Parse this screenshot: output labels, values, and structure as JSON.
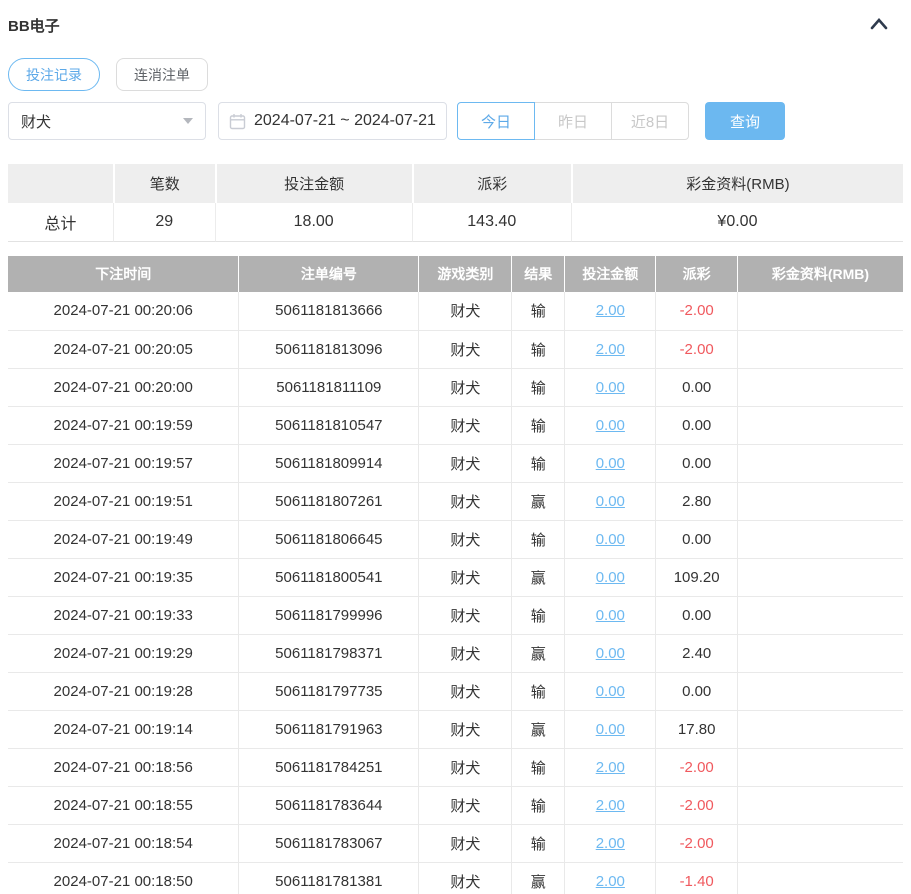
{
  "panel": {
    "title": "BB电子"
  },
  "tabs": [
    {
      "label": "投注记录",
      "active": true
    },
    {
      "label": "连消注单",
      "active": false
    }
  ],
  "filters": {
    "game_select": {
      "value": "财犬"
    },
    "date_range": {
      "value": "2024-07-21 ~ 2024-07-21"
    },
    "quick_buttons": [
      {
        "label": "今日",
        "active": true
      },
      {
        "label": "昨日",
        "active": false
      },
      {
        "label": "近8日",
        "active": false
      }
    ],
    "search_label": "查询"
  },
  "summary": {
    "headers": [
      "",
      "笔数",
      "投注金额",
      "派彩",
      "彩金资料(RMB)"
    ],
    "row": {
      "label": "总计",
      "count": "29",
      "bet_amount": "18.00",
      "payout": "143.40",
      "bonus": "¥0.00"
    }
  },
  "records": {
    "headers": [
      "下注时间",
      "注单编号",
      "游戏类别",
      "结果",
      "投注金额",
      "派彩",
      "彩金资料(RMB)"
    ],
    "rows": [
      {
        "time": "2024-07-21 00:20:06",
        "order_id": "5061181813666",
        "game": "财犬",
        "result": "输",
        "bet": "2.00",
        "payout": "-2.00",
        "bonus": ""
      },
      {
        "time": "2024-07-21 00:20:05",
        "order_id": "5061181813096",
        "game": "财犬",
        "result": "输",
        "bet": "2.00",
        "payout": "-2.00",
        "bonus": ""
      },
      {
        "time": "2024-07-21 00:20:00",
        "order_id": "5061181811109",
        "game": "财犬",
        "result": "输",
        "bet": "0.00",
        "payout": "0.00",
        "bonus": ""
      },
      {
        "time": "2024-07-21 00:19:59",
        "order_id": "5061181810547",
        "game": "财犬",
        "result": "输",
        "bet": "0.00",
        "payout": "0.00",
        "bonus": ""
      },
      {
        "time": "2024-07-21 00:19:57",
        "order_id": "5061181809914",
        "game": "财犬",
        "result": "输",
        "bet": "0.00",
        "payout": "0.00",
        "bonus": ""
      },
      {
        "time": "2024-07-21 00:19:51",
        "order_id": "5061181807261",
        "game": "财犬",
        "result": "赢",
        "bet": "0.00",
        "payout": "2.80",
        "bonus": ""
      },
      {
        "time": "2024-07-21 00:19:49",
        "order_id": "5061181806645",
        "game": "财犬",
        "result": "输",
        "bet": "0.00",
        "payout": "0.00",
        "bonus": ""
      },
      {
        "time": "2024-07-21 00:19:35",
        "order_id": "5061181800541",
        "game": "财犬",
        "result": "赢",
        "bet": "0.00",
        "payout": "109.20",
        "bonus": ""
      },
      {
        "time": "2024-07-21 00:19:33",
        "order_id": "5061181799996",
        "game": "财犬",
        "result": "输",
        "bet": "0.00",
        "payout": "0.00",
        "bonus": ""
      },
      {
        "time": "2024-07-21 00:19:29",
        "order_id": "5061181798371",
        "game": "财犬",
        "result": "赢",
        "bet": "0.00",
        "payout": "2.40",
        "bonus": ""
      },
      {
        "time": "2024-07-21 00:19:28",
        "order_id": "5061181797735",
        "game": "财犬",
        "result": "输",
        "bet": "0.00",
        "payout": "0.00",
        "bonus": ""
      },
      {
        "time": "2024-07-21 00:19:14",
        "order_id": "5061181791963",
        "game": "财犬",
        "result": "赢",
        "bet": "0.00",
        "payout": "17.80",
        "bonus": ""
      },
      {
        "time": "2024-07-21 00:18:56",
        "order_id": "5061181784251",
        "game": "财犬",
        "result": "输",
        "bet": "2.00",
        "payout": "-2.00",
        "bonus": ""
      },
      {
        "time": "2024-07-21 00:18:55",
        "order_id": "5061181783644",
        "game": "财犬",
        "result": "输",
        "bet": "2.00",
        "payout": "-2.00",
        "bonus": ""
      },
      {
        "time": "2024-07-21 00:18:54",
        "order_id": "5061181783067",
        "game": "财犬",
        "result": "输",
        "bet": "2.00",
        "payout": "-2.00",
        "bonus": ""
      },
      {
        "time": "2024-07-21 00:18:50",
        "order_id": "5061181781381",
        "game": "财犬",
        "result": "赢",
        "bet": "2.00",
        "payout": "-1.40",
        "bonus": ""
      }
    ]
  },
  "icons": {
    "collapse": "chevron-up-icon",
    "calendar": "calendar-icon",
    "select_caret": "chevron-down-icon"
  },
  "colors": {
    "accent_blue": "#6cb8f0",
    "link_blue": "#6db9f1",
    "negative_red": "#f0595e",
    "table_header_bg": "#b1b1b1",
    "summary_header_bg": "#eeeeee",
    "text": "#333333",
    "muted": "#c8c8c8"
  }
}
